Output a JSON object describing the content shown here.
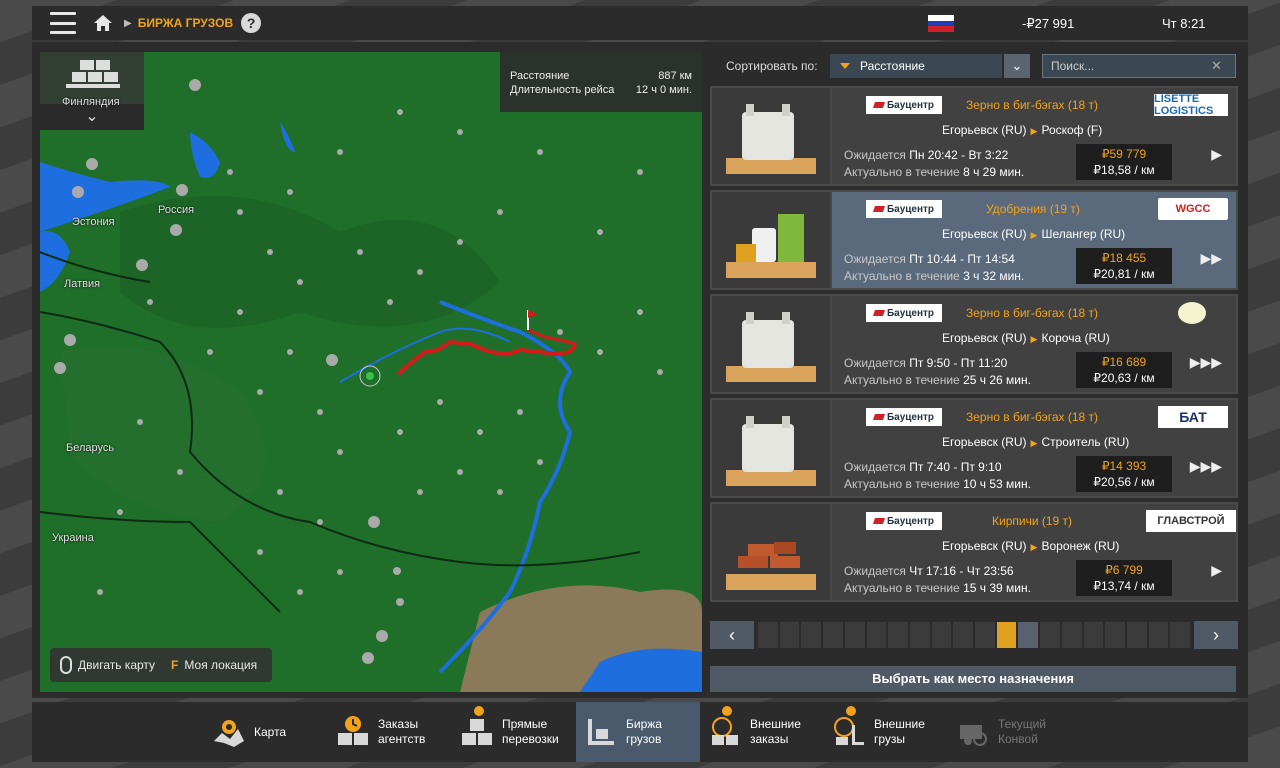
{
  "topbar": {
    "breadcrumb": "БИРЖА ГРУЗОВ",
    "help": "?",
    "money": "-₽27 991",
    "clock": "Чт 8:21"
  },
  "map": {
    "route_info": {
      "distance_label": "Расстояние",
      "distance_value": "887 км",
      "duration_label": "Длительность рейса",
      "duration_value": "12 ч 0 мин."
    },
    "labels": {
      "finland": "Финляндия",
      "estonia": "Эстония",
      "russia": "Россия",
      "latvia": "Латвия",
      "belarus": "Беларусь",
      "ukraine": "Украина"
    },
    "controls": {
      "move_map": "Двигать карту",
      "key": "F",
      "my_location": "Моя локация"
    }
  },
  "sort": {
    "label": "Сортировать по:",
    "selected": "Расстояние",
    "search_placeholder": "Поиск..."
  },
  "jobs": [
    {
      "company": "Бауцентр",
      "cargo": "Зерно в биг-бэгах (18 т)",
      "logo": "LISETTE LOGISTICS",
      "from": "Егорьевск (RU)",
      "to": "Роскоф (F)",
      "expected_label": "Ожидается",
      "expected": "Пн 20:42 - Вт 3:22",
      "valid_label": "Актуально в течение",
      "valid": "8 ч 29 мин.",
      "pay": "₽59 779",
      "rate": "₽18,58 / км",
      "go": "▶"
    },
    {
      "company": "Бауцентр",
      "cargo": "Удобрения (19 т)",
      "logo": "WGCC",
      "from": "Егорьевск (RU)",
      "to": "Шелангер (RU)",
      "expected_label": "Ожидается",
      "expected": "Пт 10:44 - Пт 14:54",
      "valid_label": "Актуально в течение",
      "valid": "3 ч 32 мин.",
      "pay": "₽18 455",
      "rate": "₽20,81 / км",
      "go": "▶▶"
    },
    {
      "company": "Бауцентр",
      "cargo": "Зерно в биг-бэгах (18 т)",
      "logo": "",
      "from": "Егорьевск (RU)",
      "to": "Короча (RU)",
      "expected_label": "Ожидается",
      "expected": "Пт 9:50 - Пт 11:20",
      "valid_label": "Актуально в течение",
      "valid": "25 ч 26 мин.",
      "pay": "₽16 689",
      "rate": "₽20,63 / км",
      "go": "▶▶▶"
    },
    {
      "company": "Бауцентр",
      "cargo": "Зерно в биг-бэгах (18 т)",
      "logo": "БАТ",
      "from": "Егорьевск (RU)",
      "to": "Строитель (RU)",
      "expected_label": "Ожидается",
      "expected": "Пт 7:40 - Пт 9:10",
      "valid_label": "Актуально в течение",
      "valid": "10 ч 53 мин.",
      "pay": "₽14 393",
      "rate": "₽20,56 / км",
      "go": "▶▶▶"
    },
    {
      "company": "Бауцентр",
      "cargo": "Кирпичи (19 т)",
      "logo": "ГЛАВСТРОЙ",
      "from": "Егорьевск (RU)",
      "to": "Воронеж (RU)",
      "expected_label": "Ожидается",
      "expected": "Чт 17:16 - Чт 23:56",
      "valid_label": "Актуально в течение",
      "valid": "15 ч 39 мин.",
      "pay": "₽6 799",
      "rate": "₽13,74 / км",
      "go": "▶"
    }
  ],
  "pager": {
    "prev": "‹",
    "next": "›",
    "total_pages": 20,
    "current_page": 12
  },
  "set_destination": "Выбрать как место назначения",
  "bottom_tabs": [
    {
      "line1": "Карта",
      "line2": ""
    },
    {
      "line1": "Заказы",
      "line2": "агентств"
    },
    {
      "line1": "Прямые",
      "line2": "перевозки"
    },
    {
      "line1": "Биржа",
      "line2": "грузов"
    },
    {
      "line1": "Внешние",
      "line2": "заказы"
    },
    {
      "line1": "Внешние",
      "line2": "грузы"
    },
    {
      "line1": "Текущий",
      "line2": "Конвой"
    }
  ],
  "colors": {
    "accent": "#f2a31b",
    "route": "#d21a1a",
    "map_land": "#1f6e2a",
    "map_water": "#1e6ee0"
  }
}
